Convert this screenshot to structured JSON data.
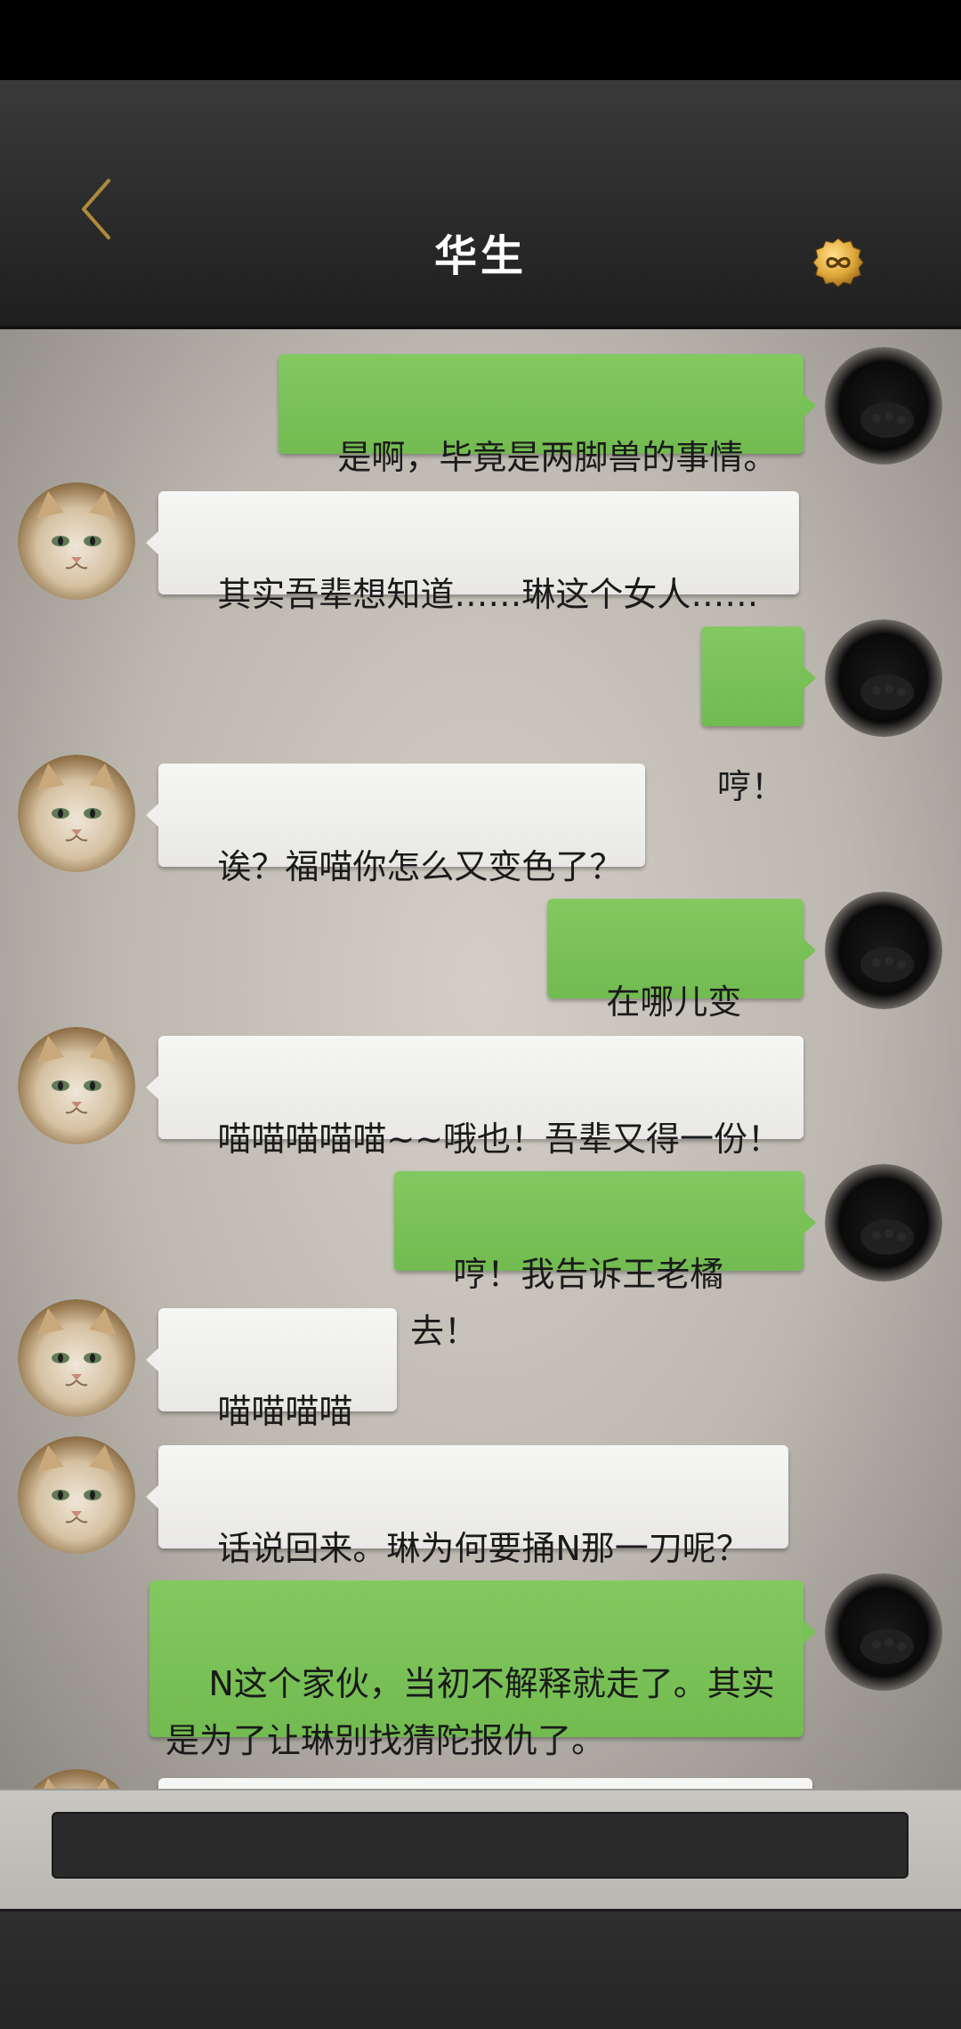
{
  "header": {
    "title": "华生",
    "back_icon": "chevron-left-icon",
    "coin_icon": "infinity-coin-icon",
    "accent_color": "#c89b3c"
  },
  "messages": [
    {
      "side": "right",
      "avatar": "black-cat-avatar",
      "text": "是啊，毕竟是两脚兽的事情。"
    },
    {
      "side": "left",
      "avatar": "cream-cat-avatar",
      "text": "其实吾辈想知道……琳这个女人……"
    },
    {
      "side": "right",
      "avatar": "black-cat-avatar",
      "text": "哼！"
    },
    {
      "side": "left",
      "avatar": "cream-cat-avatar",
      "text": "诶？福喵你怎么又变色了？"
    },
    {
      "side": "right",
      "avatar": "black-cat-avatar",
      "text": "在哪儿变的？"
    },
    {
      "side": "left",
      "avatar": "cream-cat-avatar",
      "text": "喵喵喵喵喵~~哦也！吾辈又得一份！"
    },
    {
      "side": "right",
      "avatar": "black-cat-avatar",
      "text": "哼！我告诉王老橘去！"
    },
    {
      "side": "left",
      "avatar": "cream-cat-avatar",
      "text": "喵喵喵喵~！"
    },
    {
      "side": "left",
      "avatar": "cream-cat-avatar",
      "text": "话说回来。琳为何要捅N那一刀呢？"
    },
    {
      "side": "right",
      "avatar": "black-cat-avatar",
      "text": "N这个家伙，当初不解释就走了。其实是为了让琳别找猜陀报仇了。"
    }
  ],
  "colors": {
    "right_bubble": "#7cc35a",
    "left_bubble": "#f2f1ef"
  }
}
